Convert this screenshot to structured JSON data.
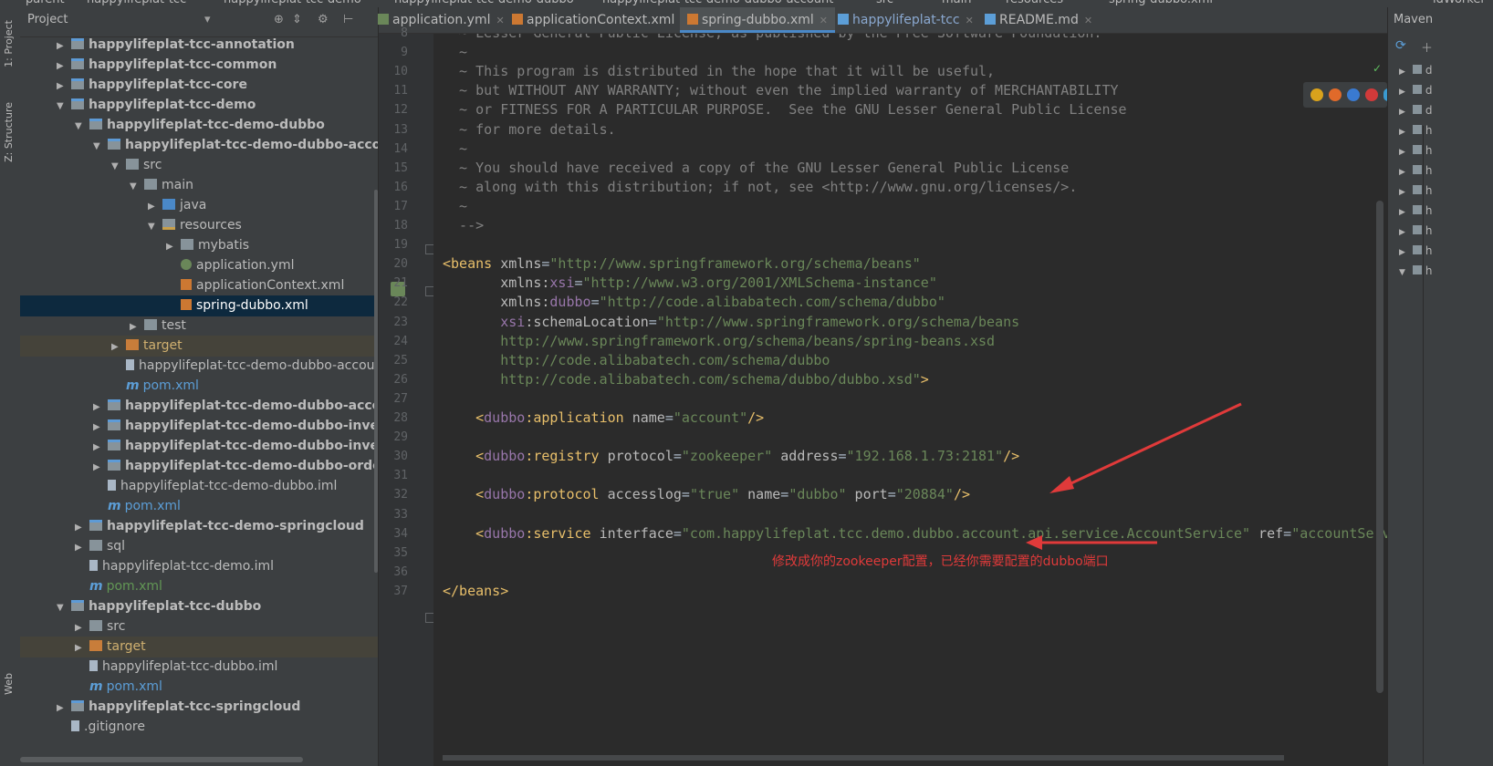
{
  "breadcrumb": [
    "parent",
    "happylifeplat-tcc",
    "happylifeplat-tcc-demo",
    "happylifeplat-tcc-demo-dubbo",
    "happylifeplat-tcc-demo-dubbo-account",
    "src",
    "main",
    "resources",
    "spring-dubbo.xml",
    "idWorker"
  ],
  "toolstrip": {
    "project_label": "1: Project",
    "structure_label": "Z: Structure",
    "web_label": "Web"
  },
  "project_panel": {
    "title": "Project",
    "tree": [
      {
        "label": "happylifeplat-tcc-annotation",
        "indent": 1,
        "arrow": "right",
        "icon": "module",
        "style": "bold"
      },
      {
        "label": "happylifeplat-tcc-common",
        "indent": 1,
        "arrow": "right",
        "icon": "module",
        "style": "bold"
      },
      {
        "label": "happylifeplat-tcc-core",
        "indent": 1,
        "arrow": "right",
        "icon": "module",
        "style": "bold"
      },
      {
        "label": "happylifeplat-tcc-demo",
        "indent": 1,
        "arrow": "down",
        "icon": "module",
        "style": "bold"
      },
      {
        "label": "happylifeplat-tcc-demo-dubbo",
        "indent": 2,
        "arrow": "down",
        "icon": "module",
        "style": "bold"
      },
      {
        "label": "happylifeplat-tcc-demo-dubbo-account",
        "indent": 3,
        "arrow": "down",
        "icon": "module",
        "style": "bold"
      },
      {
        "label": "src",
        "indent": 4,
        "arrow": "down",
        "icon": "folder",
        "style": ""
      },
      {
        "label": "main",
        "indent": 5,
        "arrow": "down",
        "icon": "folder",
        "style": ""
      },
      {
        "label": "java",
        "indent": 6,
        "arrow": "right",
        "icon": "src",
        "style": ""
      },
      {
        "label": "resources",
        "indent": 6,
        "arrow": "down",
        "icon": "res",
        "style": ""
      },
      {
        "label": "mybatis",
        "indent": 7,
        "arrow": "right",
        "icon": "folder",
        "style": ""
      },
      {
        "label": "application.yml",
        "indent": 7,
        "arrow": "",
        "icon": "yml",
        "style": ""
      },
      {
        "label": "applicationContext.xml",
        "indent": 7,
        "arrow": "",
        "icon": "xml",
        "style": ""
      },
      {
        "label": "spring-dubbo.xml",
        "indent": 7,
        "arrow": "",
        "icon": "xml",
        "style": "selected"
      },
      {
        "label": "test",
        "indent": 5,
        "arrow": "right",
        "icon": "folder",
        "style": ""
      },
      {
        "label": "target",
        "indent": 4,
        "arrow": "right",
        "icon": "target",
        "style": "excluded"
      },
      {
        "label": "happylifeplat-tcc-demo-dubbo-account.iml",
        "indent": 4,
        "arrow": "",
        "icon": "file",
        "style": ""
      },
      {
        "label": "pom.xml",
        "indent": 4,
        "arrow": "",
        "icon": "pom",
        "style": "pom-blue"
      },
      {
        "label": "happylifeplat-tcc-demo-dubbo-account-api",
        "indent": 3,
        "arrow": "right",
        "icon": "module",
        "style": "bold"
      },
      {
        "label": "happylifeplat-tcc-demo-dubbo-inventory",
        "indent": 3,
        "arrow": "right",
        "icon": "module",
        "style": "bold"
      },
      {
        "label": "happylifeplat-tcc-demo-dubbo-inventory-api",
        "indent": 3,
        "arrow": "right",
        "icon": "module",
        "style": "bold"
      },
      {
        "label": "happylifeplat-tcc-demo-dubbo-order",
        "indent": 3,
        "arrow": "right",
        "icon": "module",
        "style": "bold"
      },
      {
        "label": "happylifeplat-tcc-demo-dubbo.iml",
        "indent": 3,
        "arrow": "",
        "icon": "file",
        "style": ""
      },
      {
        "label": "pom.xml",
        "indent": 3,
        "arrow": "",
        "icon": "pom",
        "style": "pom-blue"
      },
      {
        "label": "happylifeplat-tcc-demo-springcloud",
        "indent": 2,
        "arrow": "right",
        "icon": "module",
        "style": "bold"
      },
      {
        "label": "sql",
        "indent": 2,
        "arrow": "right",
        "icon": "folder",
        "style": ""
      },
      {
        "label": "happylifeplat-tcc-demo.iml",
        "indent": 2,
        "arrow": "",
        "icon": "file",
        "style": ""
      },
      {
        "label": "pom.xml",
        "indent": 2,
        "arrow": "",
        "icon": "pom",
        "style": "pom-green"
      },
      {
        "label": "happylifeplat-tcc-dubbo",
        "indent": 1,
        "arrow": "down",
        "icon": "module",
        "style": "bold"
      },
      {
        "label": "src",
        "indent": 2,
        "arrow": "right",
        "icon": "folder",
        "style": ""
      },
      {
        "label": "target",
        "indent": 2,
        "arrow": "right",
        "icon": "target",
        "style": "excluded"
      },
      {
        "label": "happylifeplat-tcc-dubbo.iml",
        "indent": 2,
        "arrow": "",
        "icon": "file",
        "style": ""
      },
      {
        "label": "pom.xml",
        "indent": 2,
        "arrow": "",
        "icon": "pom",
        "style": "pom-blue"
      },
      {
        "label": "happylifeplat-tcc-springcloud",
        "indent": 1,
        "arrow": "right",
        "icon": "module",
        "style": "bold"
      },
      {
        "label": ".gitignore",
        "indent": 1,
        "arrow": "",
        "icon": "file",
        "style": ""
      }
    ]
  },
  "tabs": [
    {
      "label": "application.yml",
      "icon": "yml",
      "active": false
    },
    {
      "label": "applicationContext.xml",
      "icon": "xml",
      "active": false
    },
    {
      "label": "spring-dubbo.xml",
      "icon": "xml",
      "active": true
    },
    {
      "label": "happylifeplat-tcc",
      "icon": "pom",
      "active": false
    },
    {
      "label": "README.md",
      "icon": "md",
      "active": false
    }
  ],
  "editor": {
    "lines": [
      {
        "n": "8",
        "parts": [
          [
            "c-com",
            "  ~ Lesser General Public License, as published by the Free Software Foundation."
          ]
        ]
      },
      {
        "n": "9",
        "parts": [
          [
            "c-com",
            "  ~"
          ]
        ]
      },
      {
        "n": "10",
        "parts": [
          [
            "c-com",
            "  ~ This program is distributed in the hope that it will be useful,"
          ]
        ]
      },
      {
        "n": "11",
        "parts": [
          [
            "c-com",
            "  ~ but WITHOUT ANY WARRANTY; without even the implied warranty of MERCHANTABILITY"
          ]
        ]
      },
      {
        "n": "12",
        "parts": [
          [
            "c-com",
            "  ~ or FITNESS FOR A PARTICULAR PURPOSE.  See the GNU Lesser General Public License"
          ]
        ]
      },
      {
        "n": "13",
        "parts": [
          [
            "c-com",
            "  ~ for more details."
          ]
        ]
      },
      {
        "n": "14",
        "parts": [
          [
            "c-com",
            "  ~"
          ]
        ]
      },
      {
        "n": "15",
        "parts": [
          [
            "c-com",
            "  ~ You should have received a copy of the GNU Lesser General Public License"
          ]
        ]
      },
      {
        "n": "16",
        "parts": [
          [
            "c-com",
            "  ~ along with this distribution; if not, see <http://www.gnu.org/licenses/>."
          ]
        ]
      },
      {
        "n": "17",
        "parts": [
          [
            "c-com",
            "  ~"
          ]
        ]
      },
      {
        "n": "18",
        "parts": [
          [
            "c-com",
            "  -->"
          ]
        ]
      },
      {
        "n": "19",
        "parts": []
      },
      {
        "n": "20",
        "parts": [
          [
            "c-tag",
            "<beans "
          ],
          [
            "c-attr",
            "xmlns"
          ],
          [
            "c-plain",
            "="
          ],
          [
            "c-val",
            "\"http://www.springframework.org/schema/beans\""
          ]
        ]
      },
      {
        "n": "21",
        "parts": [
          [
            "c-attr",
            "       xmlns:"
          ],
          [
            "c-ns",
            "xsi"
          ],
          [
            "c-plain",
            "="
          ],
          [
            "c-val",
            "\"http://www.w3.org/2001/XMLSchema-instance\""
          ]
        ]
      },
      {
        "n": "22",
        "parts": [
          [
            "c-attr",
            "       xmlns:"
          ],
          [
            "c-ns",
            "dubbo"
          ],
          [
            "c-plain",
            "="
          ],
          [
            "c-val",
            "\"http://code.alibabatech.com/schema/dubbo\""
          ]
        ]
      },
      {
        "n": "23",
        "parts": [
          [
            "c-ns",
            "       xsi"
          ],
          [
            "c-attr",
            ":schemaLocation"
          ],
          [
            "c-plain",
            "="
          ],
          [
            "c-val",
            "\"http://www.springframework.org/schema/beans"
          ]
        ]
      },
      {
        "n": "24",
        "parts": [
          [
            "c-val",
            "       http://www.springframework.org/schema/beans/spring-beans.xsd"
          ]
        ]
      },
      {
        "n": "25",
        "parts": [
          [
            "c-val",
            "       http://code.alibabatech.com/schema/dubbo"
          ]
        ]
      },
      {
        "n": "26",
        "parts": [
          [
            "c-val",
            "       http://code.alibabatech.com/schema/dubbo/dubbo.xsd\""
          ],
          [
            "c-tag",
            ">"
          ]
        ]
      },
      {
        "n": "27",
        "parts": []
      },
      {
        "n": "28",
        "parts": [
          [
            "c-tag",
            "    <"
          ],
          [
            "c-ns",
            "dubbo"
          ],
          [
            "c-tag",
            ":application "
          ],
          [
            "c-attr",
            "name"
          ],
          [
            "c-plain",
            "="
          ],
          [
            "c-val",
            "\"account\""
          ],
          [
            "c-tag",
            "/>"
          ]
        ]
      },
      {
        "n": "29",
        "parts": []
      },
      {
        "n": "30",
        "parts": [
          [
            "c-tag",
            "    <"
          ],
          [
            "c-ns",
            "dubbo"
          ],
          [
            "c-tag",
            ":registry "
          ],
          [
            "c-attr",
            "protocol"
          ],
          [
            "c-plain",
            "="
          ],
          [
            "c-val",
            "\"zookeeper\""
          ],
          [
            "c-attr",
            " address"
          ],
          [
            "c-plain",
            "="
          ],
          [
            "c-val",
            "\"192.168.1.73:2181\""
          ],
          [
            "c-tag",
            "/>"
          ]
        ]
      },
      {
        "n": "31",
        "parts": []
      },
      {
        "n": "32",
        "parts": [
          [
            "c-tag",
            "    <"
          ],
          [
            "c-ns",
            "dubbo"
          ],
          [
            "c-tag",
            ":protocol "
          ],
          [
            "c-attr",
            "accesslog"
          ],
          [
            "c-plain",
            "="
          ],
          [
            "c-val",
            "\"true\""
          ],
          [
            "c-attr",
            " name"
          ],
          [
            "c-plain",
            "="
          ],
          [
            "c-val",
            "\"dubbo\""
          ],
          [
            "c-attr",
            " port"
          ],
          [
            "c-plain",
            "="
          ],
          [
            "c-val",
            "\"20884\""
          ],
          [
            "c-tag",
            "/>"
          ]
        ]
      },
      {
        "n": "33",
        "parts": []
      },
      {
        "n": "34",
        "parts": [
          [
            "c-tag",
            "    <"
          ],
          [
            "c-ns",
            "dubbo"
          ],
          [
            "c-tag",
            ":service "
          ],
          [
            "c-attr",
            "interface"
          ],
          [
            "c-plain",
            "="
          ],
          [
            "c-val",
            "\"com.happylifeplat.tcc.demo.dubbo.account.api.service.AccountService\""
          ],
          [
            "c-attr",
            " ref"
          ],
          [
            "c-plain",
            "="
          ],
          [
            "c-val",
            "\"accountService\""
          ]
        ]
      },
      {
        "n": "35",
        "parts": []
      },
      {
        "n": "36",
        "parts": []
      },
      {
        "n": "37",
        "parts": [
          [
            "c-tag",
            "</beans>"
          ]
        ]
      }
    ],
    "annotation": "修改成你的zookeeper配置，已经你需要配置的dubbo端口"
  },
  "maven_panel": {
    "title": "Maven",
    "rows": [
      "d",
      "d",
      "d",
      "h",
      "h",
      "h",
      "h",
      "h",
      "h",
      "h",
      "h"
    ]
  },
  "colors": {
    "background": "#2b2b2b",
    "panel": "#3c3f41",
    "selection": "#0d293e",
    "annotation_red": "#e03a3a",
    "xml_tag": "#e8bf6a",
    "xml_value": "#6a8759",
    "comment": "#808080"
  },
  "icons": [
    "module-folder-icon",
    "folder-icon",
    "source-folder-icon",
    "resources-folder-icon",
    "yml-file-icon",
    "xml-file-icon",
    "iml-file-icon",
    "maven-pom-icon",
    "chrome-icon",
    "firefox-icon",
    "safari-icon",
    "opera-icon",
    "ie-icon",
    "refresh-icon",
    "gear-icon"
  ]
}
